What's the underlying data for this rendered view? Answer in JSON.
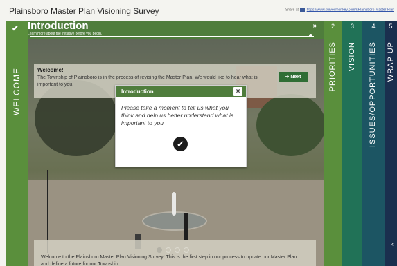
{
  "header": {
    "title": "Plainsboro Master Plan Visioning Survey",
    "share_prefix": "Share at",
    "share_url": "https://www.surveymonkey.com/r/Plainsboro-Master-Plan"
  },
  "welcome_tab": {
    "label": "WELCOME",
    "status_icon": "checkmark"
  },
  "section": {
    "title": "Introduction",
    "subtitle": "Learn more about the initiative before you begin.",
    "progress": 1.0
  },
  "welcome_box": {
    "heading": "Welcome!",
    "body": "The Township of Plainsboro is in the process of revising the Master Plan. We would like to hear what is important to you.",
    "next_label": "Next"
  },
  "modal": {
    "title": "Introduction",
    "close_label": "×",
    "body": "Please take a moment to tell us what you think and help us better understand what is important to you"
  },
  "carousel": {
    "count": 4,
    "active_index": 0
  },
  "caption": "Welcome to the Plainsboro Master Plan Visioning Survey! This is the first step in our process to update our Master Plan and define a future for our Township.",
  "side_tabs": [
    {
      "number": "2",
      "label": "PRIORITIES",
      "color": "#5a8f3c"
    },
    {
      "number": "3",
      "label": "VISION",
      "color": "#217257"
    },
    {
      "number": "4",
      "label": "ISSUES/OPPORTUNITIES",
      "color": "#1c5563"
    },
    {
      "number": "5",
      "label": "WRAP UP",
      "color": "#1a2f4e"
    }
  ],
  "colors": {
    "accent_green": "#4f7d3c",
    "button_green": "#2f6e35"
  }
}
